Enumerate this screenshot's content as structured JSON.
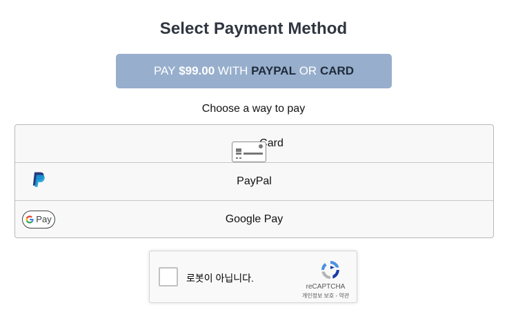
{
  "header": {
    "title": "Select Payment Method"
  },
  "pay_button": {
    "prefix": "PAY",
    "amount": "$99.00",
    "with": "WITH",
    "option1": "PAYPAL",
    "or": "OR",
    "option2": "CARD"
  },
  "subtitle": "Choose a way to pay",
  "methods": [
    {
      "label": "Card",
      "icon": "credit-card-icon"
    },
    {
      "label": "PayPal",
      "icon": "paypal-icon"
    },
    {
      "label": "Google Pay",
      "icon": "google-pay-icon",
      "badge_text": "Pay"
    }
  ],
  "recaptcha": {
    "label": "로봇이 아닙니다.",
    "brand": "reCAPTCHA",
    "privacy": "개인정보 보호",
    "separator": "-",
    "terms": "약관"
  },
  "colors": {
    "pay_button_bg": "#97aecc",
    "pay_button_dark_text": "#1f2b3a",
    "paypal_dark": "#253b80",
    "paypal_light": "#179bd7"
  }
}
